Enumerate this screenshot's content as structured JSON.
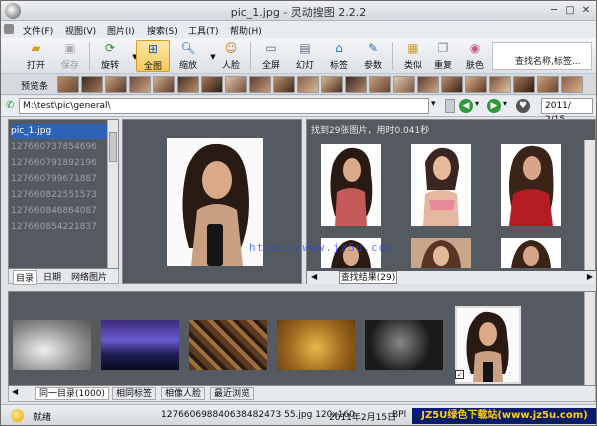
{
  "window": {
    "title": "pic_1.jpg - 灵动搜图 2.2.2"
  },
  "menu": [
    "文件(F)",
    "视图(V)",
    "图片(I)",
    "搜索(S)",
    "工具(T)",
    "帮助(H)"
  ],
  "toolbar": {
    "open": "打开",
    "save": "保存",
    "rotate": "旋转",
    "fullview": "全图",
    "zoom": "缩放",
    "face": "人脸",
    "fullscreen": "全屏",
    "slideshow": "幻灯",
    "tag": "标签",
    "params": "参数",
    "similar": "类似",
    "duplicate": "重复",
    "skin": "肤色",
    "search_placeholder": "查找名称,标签..."
  },
  "preview_bar": {
    "label": "预览条"
  },
  "address": {
    "path": "M:\\test\\pic\\general\\",
    "date": "2011/  2/15"
  },
  "files": [
    "pic_1.jpg",
    "127660737854696",
    "127660791892196",
    "127660799671887",
    "127660822551573",
    "127660846864087",
    "127660854221837"
  ],
  "left_tabs": [
    "目录",
    "日期",
    "网络图片"
  ],
  "results": {
    "status": "找到29张图片，用时0.041秒",
    "tab_label": "查找结果(29)"
  },
  "bottom_tabs": [
    "同一目录(1000)",
    "相同标签",
    "相像人脸",
    "最近浏览"
  ],
  "statusbar": {
    "state": "就绪",
    "file_info": "1276606988406384824735 5.jpg 120x160",
    "file_info_full": "127660698840638482473 55.jpg 120x160",
    "date": "2011年2月15日",
    "extra": "BPl"
  },
  "watermark": {
    "text": "JZ5U绿色下载站(www.jz5u.com)",
    "url": "http://www.jz5u.com"
  },
  "colors": {
    "accent": "#2f62b5",
    "panel_bg": "#555a60",
    "active_btn": "#f8c95a"
  }
}
